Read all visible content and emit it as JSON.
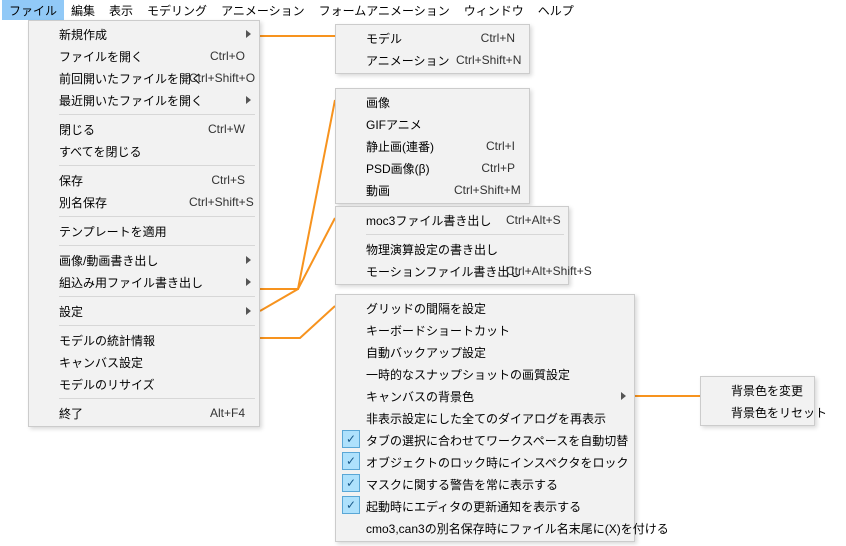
{
  "menubar": {
    "items": [
      "ファイル",
      "編集",
      "表示",
      "モデリング",
      "アニメーション",
      "フォームアニメーション",
      "ウィンドウ",
      "ヘルプ"
    ],
    "active_index": 0
  },
  "file_menu": {
    "items": [
      {
        "label": "新規作成",
        "submenu": true
      },
      {
        "label": "ファイルを開く",
        "shortcut": "Ctrl+O"
      },
      {
        "label": "前回開いたファイルを開く",
        "shortcut": "Ctrl+Shift+O"
      },
      {
        "label": "最近開いたファイルを開く",
        "submenu": true
      },
      {
        "sep": true
      },
      {
        "label": "閉じる",
        "shortcut": "Ctrl+W"
      },
      {
        "label": "すべてを閉じる"
      },
      {
        "sep": true
      },
      {
        "label": "保存",
        "shortcut": "Ctrl+S"
      },
      {
        "label": "別名保存",
        "shortcut": "Ctrl+Shift+S"
      },
      {
        "sep": true
      },
      {
        "label": "テンプレートを適用"
      },
      {
        "sep": true
      },
      {
        "label": "画像/動画書き出し",
        "submenu": true
      },
      {
        "label": "組込み用ファイル書き出し",
        "submenu": true
      },
      {
        "sep": true
      },
      {
        "label": "設定",
        "submenu": true
      },
      {
        "sep": true
      },
      {
        "label": "モデルの統計情報"
      },
      {
        "label": "キャンバス設定"
      },
      {
        "label": "モデルのリサイズ"
      },
      {
        "sep": true
      },
      {
        "label": "終了",
        "shortcut": "Alt+F4"
      }
    ]
  },
  "new_menu": {
    "items": [
      {
        "label": "モデル",
        "shortcut": "Ctrl+N"
      },
      {
        "label": "アニメーション",
        "shortcut": "Ctrl+Shift+N"
      }
    ]
  },
  "export_menu": {
    "items": [
      {
        "label": "画像"
      },
      {
        "label": "GIFアニメ"
      },
      {
        "label": "静止画(連番)",
        "shortcut": "Ctrl+I"
      },
      {
        "label": "PSD画像(β)",
        "shortcut": "Ctrl+P"
      },
      {
        "label": "動画",
        "shortcut": "Ctrl+Shift+M"
      }
    ]
  },
  "embed_menu": {
    "items": [
      {
        "label": "moc3ファイル書き出し",
        "shortcut": "Ctrl+Alt+S"
      },
      {
        "sep": true
      },
      {
        "label": "物理演算設定の書き出し"
      },
      {
        "label": "モーションファイル書き出し",
        "shortcut": "Ctrl+Alt+Shift+S"
      }
    ]
  },
  "settings_menu": {
    "items": [
      {
        "label": "グリッドの間隔を設定"
      },
      {
        "label": "キーボードショートカット"
      },
      {
        "label": "自動バックアップ設定"
      },
      {
        "label": "一時的なスナップショットの画質設定"
      },
      {
        "label": "キャンバスの背景色",
        "submenu": true
      },
      {
        "label": "非表示設定にした全てのダイアログを再表示"
      },
      {
        "label": "タブの選択に合わせてワークスペースを自動切替",
        "checked": true
      },
      {
        "label": "オブジェクトのロック時にインスペクタをロック",
        "checked": true
      },
      {
        "label": "マスクに関する警告を常に表示する",
        "checked": true
      },
      {
        "label": "起動時にエディタの更新通知を表示する",
        "checked": true
      },
      {
        "label": "cmo3,can3の別名保存時にファイル名末尾に(X)を付ける"
      }
    ]
  },
  "bg_menu": {
    "items": [
      {
        "label": "背景色を変更"
      },
      {
        "label": "背景色をリセット"
      }
    ]
  },
  "colors": {
    "connector": "#f7931e"
  }
}
